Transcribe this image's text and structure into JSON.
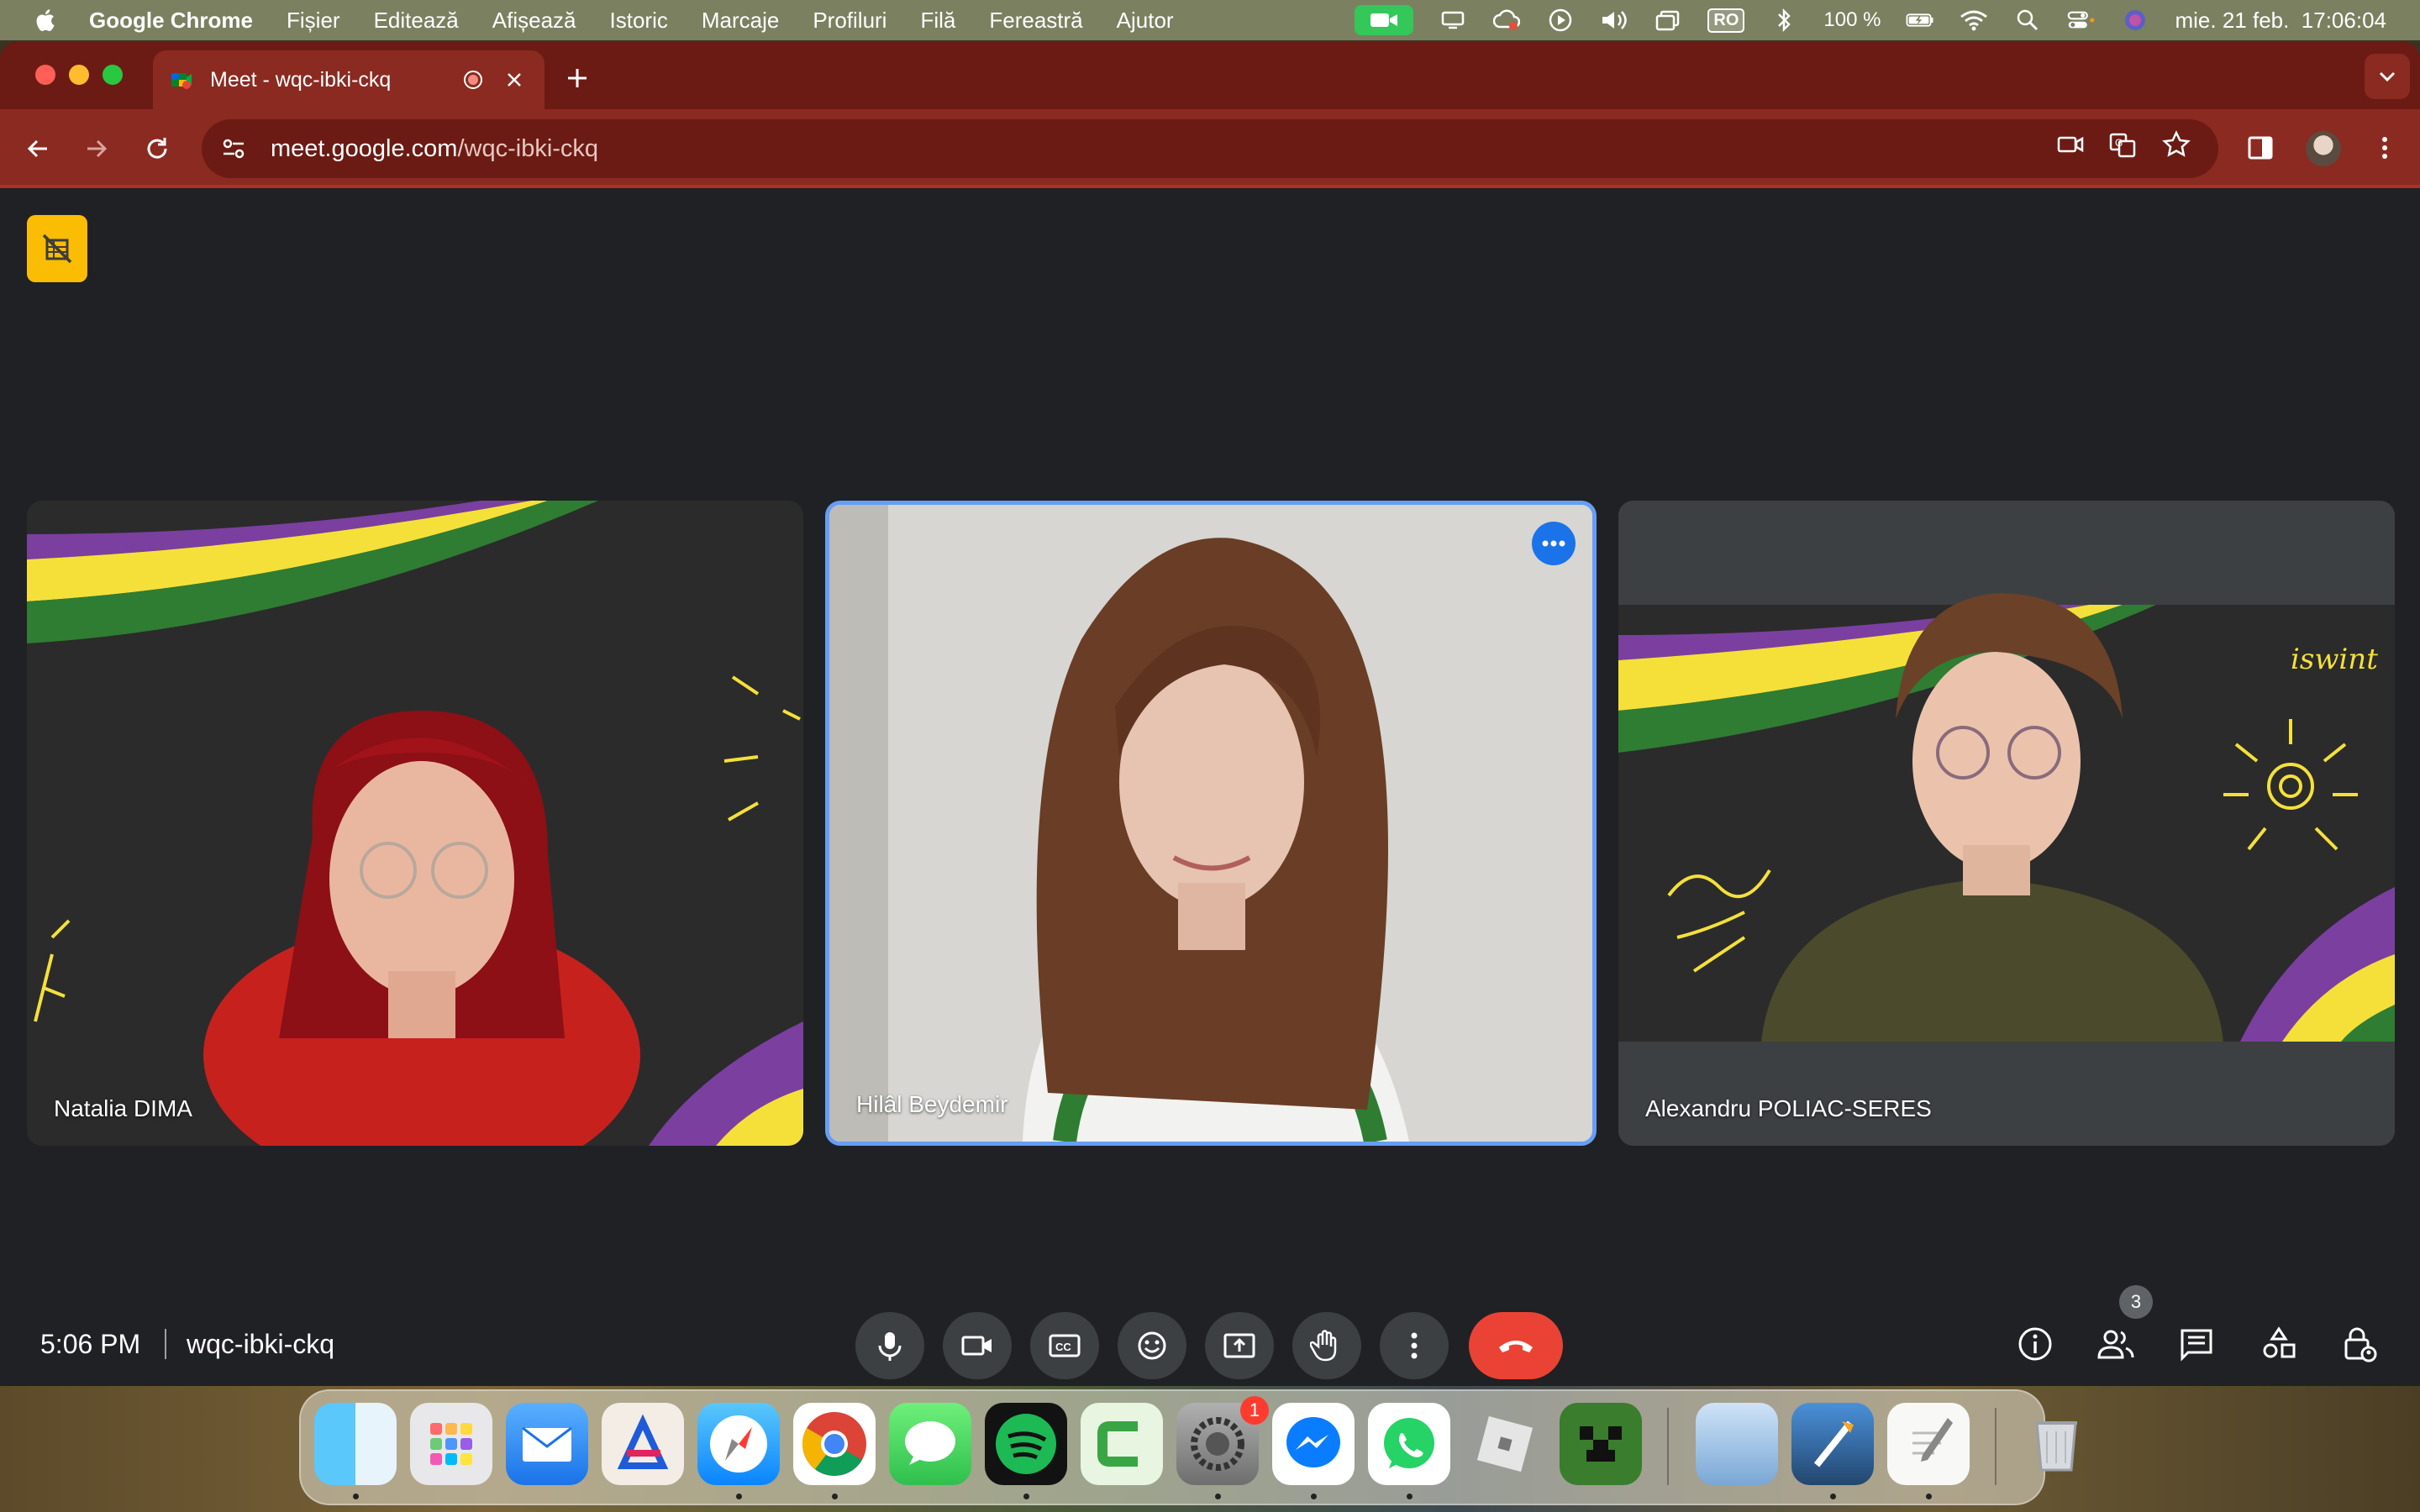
{
  "menubar": {
    "app_name": "Google Chrome",
    "items": [
      "Fișier",
      "Editează",
      "Afișează",
      "Istoric",
      "Marcaje",
      "Profiluri",
      "Filă",
      "Fereastră",
      "Ajutor"
    ],
    "battery": "100 %",
    "input_source": "RO",
    "datetime": "mie. 21 feb.  17:06:04"
  },
  "browser": {
    "tab_title": "Meet - wqc-ibki-ckq",
    "url_host": "meet.google.com",
    "url_path": "/wqc-ibki-ckq"
  },
  "meeting": {
    "participants": [
      {
        "name": "Natalia DIMA"
      },
      {
        "name": "Hilâl Beydemir"
      },
      {
        "name": "Alexandru POLIAC-SERES"
      }
    ],
    "time": "5:06 PM",
    "code": "wqc-ibki-ckq",
    "people_count": "3"
  },
  "dock": {
    "notification_badge": "1",
    "apps": [
      "finder-icon",
      "launchpad-icon",
      "mail-icon",
      "affinity-icon",
      "safari-icon",
      "chrome-icon",
      "messages-icon",
      "spotify-icon",
      "camtasia-icon",
      "settings-icon",
      "messenger-icon",
      "whatsapp-icon",
      "roblox-icon",
      "minecraft-icon",
      "preview-icon",
      "xcode-icon",
      "textedit-icon",
      "trash-icon"
    ]
  },
  "colors": {
    "tab_strip": "#6b1b14",
    "toolbar": "#8b2a20",
    "meet_bg": "#202124",
    "active_speaker": "#669df6",
    "hangup": "#ea4335"
  }
}
